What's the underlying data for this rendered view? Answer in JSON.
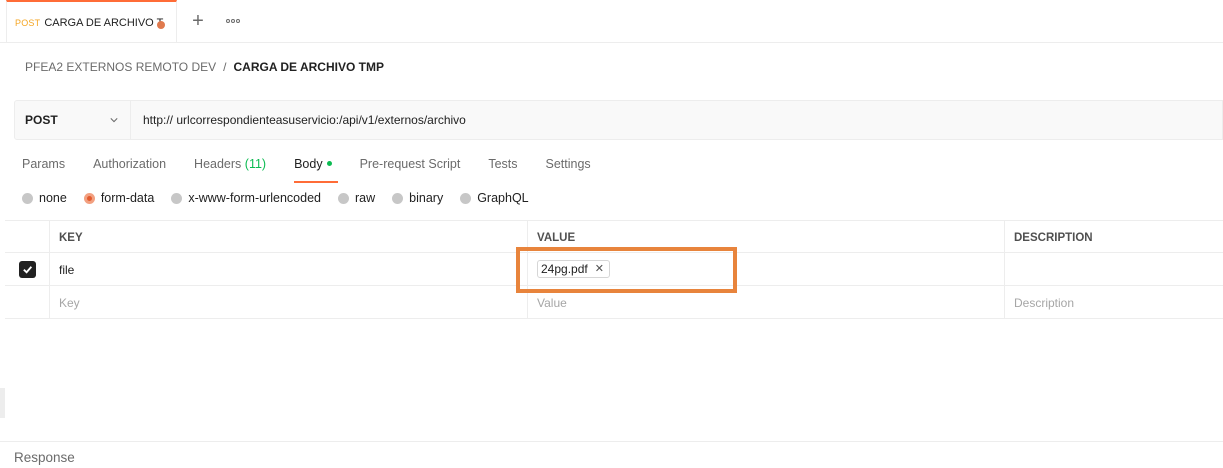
{
  "tab": {
    "method": "POST",
    "title": "CARGA DE ARCHIVO T",
    "unsaved": true,
    "add_icon": "plus-icon",
    "more_icon": "more-horizontal-icon"
  },
  "breadcrumb": {
    "collection": "PFEA2 EXTERNOS REMOTO DEV",
    "separator": "/",
    "request": "CARGA DE ARCHIVO TMP"
  },
  "request": {
    "method": "POST",
    "url_prefix": "http:// ",
    "url_host": "urlcorrespondienteasuservicio",
    "url_path": ":/api/v1/externos/archivo"
  },
  "request_tabs": [
    {
      "label": "Params"
    },
    {
      "label": "Authorization"
    },
    {
      "label": "Headers",
      "count": "(11)"
    },
    {
      "label": "Body",
      "active": true
    },
    {
      "label": "Pre-request Script"
    },
    {
      "label": "Tests"
    },
    {
      "label": "Settings"
    }
  ],
  "body_types": [
    {
      "label": "none"
    },
    {
      "label": "form-data",
      "selected": true
    },
    {
      "label": "x-www-form-urlencoded"
    },
    {
      "label": "raw"
    },
    {
      "label": "binary"
    },
    {
      "label": "GraphQL"
    }
  ],
  "params_table": {
    "headers": {
      "key": "KEY",
      "value": "VALUE",
      "description": "DESCRIPTION"
    },
    "rows": [
      {
        "checked": true,
        "key": "file",
        "value_file": "24pg.pdf",
        "description": ""
      }
    ],
    "placeholder_row": {
      "key": "Key",
      "value": "Value",
      "description": "Description"
    }
  },
  "response": {
    "label": "Response"
  },
  "colors": {
    "accent": "#ff6c37",
    "highlight_box": "#e8843c",
    "body_indicator": "#0cbb52",
    "tab_method": "#f5a623"
  }
}
